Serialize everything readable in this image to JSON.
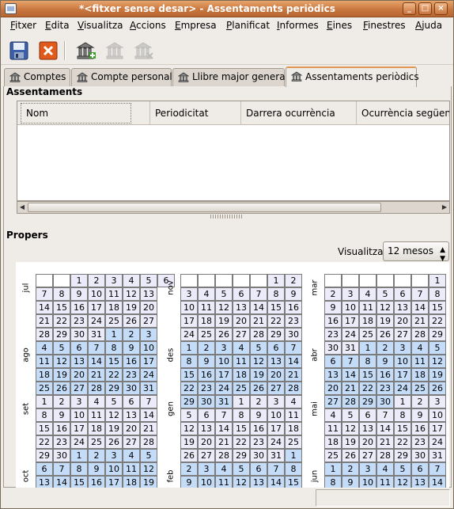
{
  "window": {
    "title": "*<fitxer sense desar> - Assentaments periòdics"
  },
  "menu": [
    "Fitxer",
    "Edita",
    "Visualitza",
    "Accions",
    "Empresa",
    "Planificat",
    "Informes",
    "Eines",
    "Finestres",
    "Ajuda"
  ],
  "tabs": [
    "Comptes",
    "Compte personal",
    "Llibre major general",
    "Assentaments periòdics"
  ],
  "assentaments": {
    "section_title": "Assentaments",
    "columns": [
      "Nom",
      "Periodicitat",
      "Darrera ocurrència",
      "Ocurrència següent"
    ]
  },
  "propers": {
    "section_title": "Propers",
    "view_label": "Visualitza:",
    "view_value": "12 mesos"
  },
  "calendar": {
    "columns": [
      {
        "months": [
          "jul",
          "ago",
          "set",
          "oct"
        ]
      },
      {
        "months": [
          "nov",
          "des",
          "gen",
          "feb"
        ]
      },
      {
        "months": [
          "mar",
          "abr",
          "mai",
          "jun"
        ]
      }
    ],
    "weeks": [
      [
        [
          "",
          "",
          "1",
          "2",
          "3",
          "4",
          "5",
          "6"
        ],
        [
          "",
          "",
          "",
          "",
          "",
          "1",
          "2"
        ],
        [
          "",
          "",
          "",
          "",
          "",
          "",
          "1"
        ]
      ],
      [
        [
          "7",
          "8",
          "9",
          "10",
          "11",
          "12",
          "13"
        ],
        [
          "3",
          "4",
          "5",
          "6",
          "7",
          "8",
          "9"
        ],
        [
          "2",
          "3",
          "4",
          "5",
          "6",
          "7",
          "8"
        ]
      ],
      [
        [
          "14",
          "15",
          "16",
          "17",
          "18",
          "19",
          "20"
        ],
        [
          "10",
          "11",
          "12",
          "13",
          "14",
          "15",
          "16"
        ],
        [
          "9",
          "10",
          "11",
          "12",
          "13",
          "14",
          "15"
        ]
      ],
      [
        [
          "21",
          "22",
          "23",
          "24",
          "25",
          "26",
          "27"
        ],
        [
          "17",
          "18",
          "19",
          "20",
          "21",
          "22",
          "23"
        ],
        [
          "16",
          "17",
          "18",
          "19",
          "20",
          "21",
          "22"
        ]
      ],
      [
        [
          "28",
          "29",
          "30",
          "31",
          "1",
          "2",
          "3"
        ],
        [
          "24",
          "25",
          "26",
          "27",
          "28",
          "29",
          "30"
        ],
        [
          "23",
          "24",
          "25",
          "26",
          "27",
          "28",
          "29"
        ]
      ],
      [
        [
          "4",
          "5",
          "6",
          "7",
          "8",
          "9",
          "10"
        ],
        [
          "1",
          "2",
          "3",
          "4",
          "5",
          "6",
          "7"
        ],
        [
          "30",
          "31",
          "1",
          "2",
          "3",
          "4",
          "5"
        ]
      ],
      [
        [
          "11",
          "12",
          "13",
          "14",
          "15",
          "16",
          "17"
        ],
        [
          "8",
          "9",
          "10",
          "11",
          "12",
          "13",
          "14"
        ],
        [
          "6",
          "7",
          "8",
          "9",
          "10",
          "11",
          "12"
        ]
      ],
      [
        [
          "18",
          "19",
          "20",
          "21",
          "22",
          "23",
          "24"
        ],
        [
          "15",
          "16",
          "17",
          "18",
          "19",
          "20",
          "21"
        ],
        [
          "13",
          "14",
          "15",
          "16",
          "17",
          "18",
          "19"
        ]
      ],
      [
        [
          "25",
          "26",
          "27",
          "28",
          "29",
          "30",
          "31"
        ],
        [
          "22",
          "23",
          "24",
          "25",
          "26",
          "27",
          "28"
        ],
        [
          "20",
          "21",
          "22",
          "23",
          "24",
          "25",
          "26"
        ]
      ],
      [
        [
          "1",
          "2",
          "3",
          "4",
          "5",
          "6",
          "7"
        ],
        [
          "29",
          "30",
          "31",
          "1",
          "2",
          "3",
          "4"
        ],
        [
          "27",
          "28",
          "29",
          "30",
          "1",
          "2",
          "3"
        ]
      ],
      [
        [
          "8",
          "9",
          "10",
          "11",
          "12",
          "13",
          "14"
        ],
        [
          "5",
          "6",
          "7",
          "8",
          "9",
          "10",
          "11"
        ],
        [
          "4",
          "5",
          "6",
          "7",
          "8",
          "9",
          "10"
        ]
      ],
      [
        [
          "15",
          "16",
          "17",
          "18",
          "19",
          "20",
          "21"
        ],
        [
          "12",
          "13",
          "14",
          "15",
          "16",
          "17",
          "18"
        ],
        [
          "11",
          "12",
          "13",
          "14",
          "15",
          "16",
          "17"
        ]
      ],
      [
        [
          "22",
          "23",
          "24",
          "25",
          "26",
          "27",
          "28"
        ],
        [
          "19",
          "20",
          "21",
          "22",
          "23",
          "24",
          "25"
        ],
        [
          "18",
          "19",
          "20",
          "21",
          "22",
          "23",
          "24"
        ]
      ],
      [
        [
          "29",
          "30",
          "1",
          "2",
          "3",
          "4",
          "5"
        ],
        [
          "26",
          "27",
          "28",
          "29",
          "30",
          "31",
          "1"
        ],
        [
          "25",
          "26",
          "27",
          "28",
          "29",
          "30",
          "31"
        ]
      ],
      [
        [
          "6",
          "7",
          "8",
          "9",
          "10",
          "11",
          "12"
        ],
        [
          "2",
          "3",
          "4",
          "5",
          "6",
          "7",
          "8"
        ],
        [
          "1",
          "2",
          "3",
          "4",
          "5",
          "6",
          "7"
        ]
      ],
      [
        [
          "13",
          "14",
          "15",
          "16",
          "17",
          "18",
          "19"
        ],
        [
          "9",
          "10",
          "11",
          "12",
          "13",
          "14",
          "15"
        ],
        [
          "8",
          "9",
          "10",
          "11",
          "12",
          "13",
          "14"
        ]
      ]
    ],
    "colors": {
      "month_a": "#ecebf9",
      "month_b": "#c4dcf8",
      "empty": "#ffffff"
    }
  }
}
